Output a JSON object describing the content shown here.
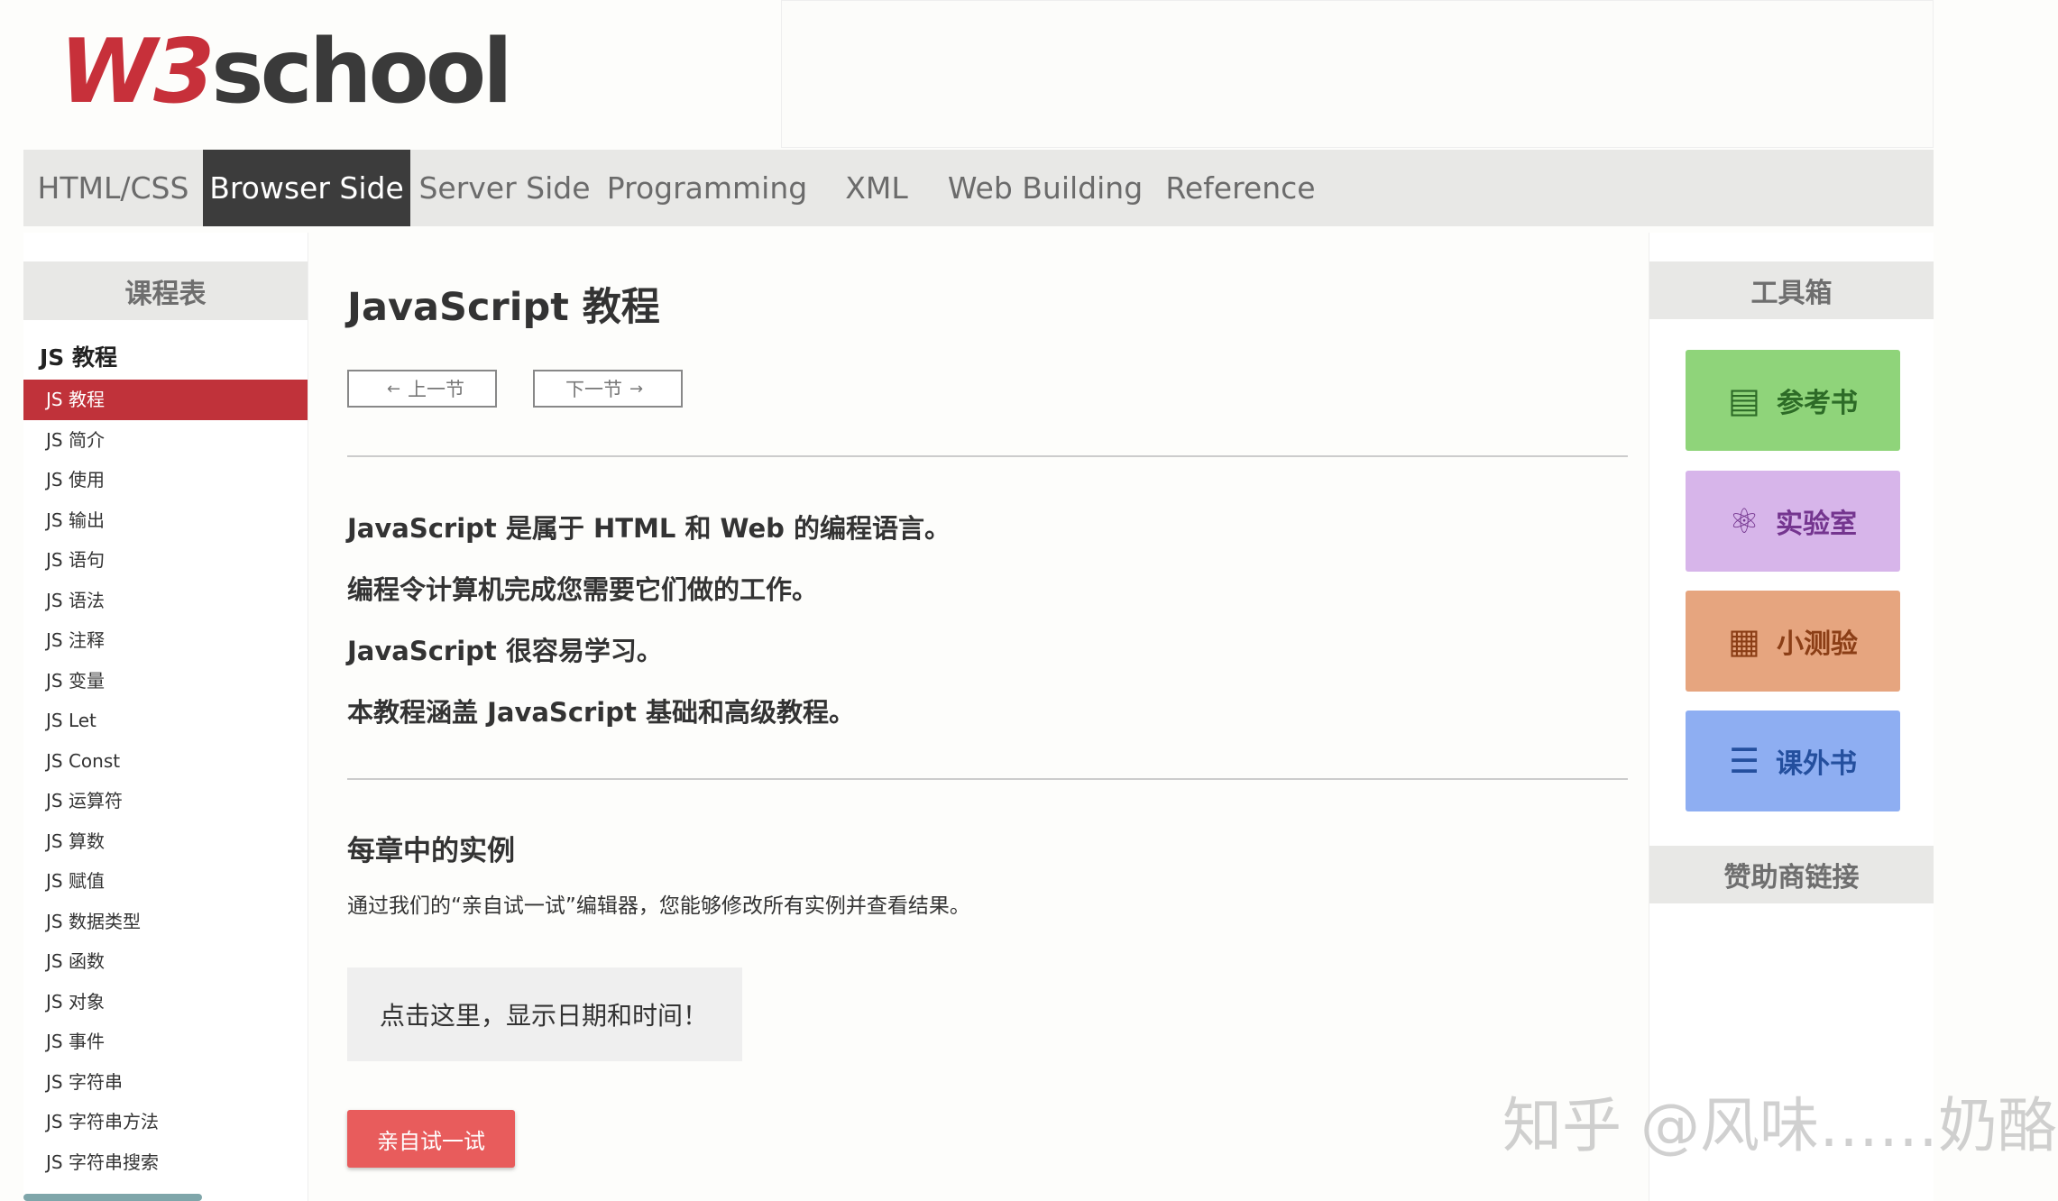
{
  "header": {
    "logo_w3": "W3",
    "logo_school": "school"
  },
  "topnav": [
    {
      "label": "HTML/CSS",
      "active": false
    },
    {
      "label": "Browser Side",
      "active": true
    },
    {
      "label": "Server Side",
      "active": false
    },
    {
      "label": "Programming",
      "active": false
    },
    {
      "label": "XML",
      "active": false
    },
    {
      "label": "Web Building",
      "active": false
    },
    {
      "label": "Reference",
      "active": false
    }
  ],
  "leftnav": {
    "heading": "课程表",
    "section": "JS 教程",
    "items": [
      "JS 教程",
      "JS 简介",
      "JS 使用",
      "JS 输出",
      "JS 语句",
      "JS 语法",
      "JS 注释",
      "JS 变量",
      "JS Let",
      "JS Const",
      "JS 运算符",
      "JS 算数",
      "JS 赋值",
      "JS 数据类型",
      "JS 函数",
      "JS 对象",
      "JS 事件",
      "JS 字符串",
      "JS 字符串方法",
      "JS 字符串搜索"
    ],
    "active_index": 0
  },
  "main": {
    "title": "JavaScript 教程",
    "prev_label": "上一节",
    "next_label": "下一节",
    "intro": [
      "JavaScript 是属于 HTML 和 Web 的编程语言。",
      "编程令计算机完成您需要它们做的工作。",
      "JavaScript 很容易学习。",
      "本教程涵盖 JavaScript 基础和高级教程。"
    ],
    "examples_heading": "每章中的实例",
    "examples_desc": "通过我们的“亲自试一试”编辑器，您能够修改所有实例并查看结果。",
    "demo_text": "点击这里，显示日期和时间！",
    "try_button": "亲自试一试"
  },
  "rightnav": {
    "tools_heading": "工具箱",
    "tools": [
      {
        "label": "参考书",
        "icon": "book-icon",
        "color": "#8fd47a"
      },
      {
        "label": "实验室",
        "icon": "atom-icon",
        "color": "#d7b5ea"
      },
      {
        "label": "小测验",
        "icon": "clipboard-icon",
        "color": "#e6a57f"
      },
      {
        "label": "课外书",
        "icon": "stack-icon",
        "color": "#8eaef2"
      }
    ],
    "sponsor_heading": "赞助商链接"
  },
  "watermark": "知乎 @风味……奶酪",
  "colors": {
    "brand_red": "#c0323a",
    "nav_active": "#3c3c3c",
    "try_button": "#e85c5c"
  }
}
